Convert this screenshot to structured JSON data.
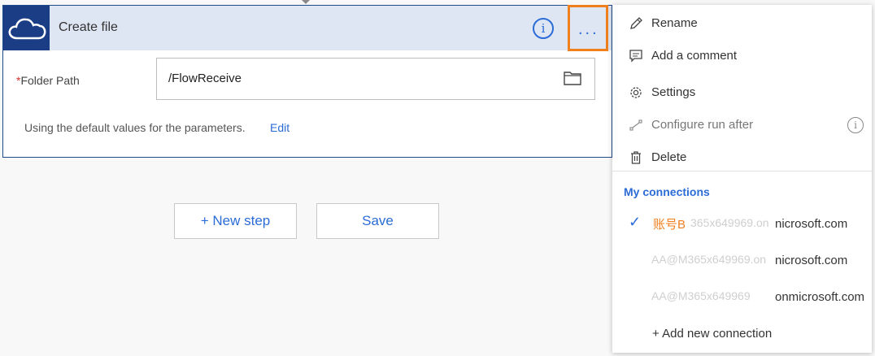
{
  "card": {
    "title": "Create file",
    "info_icon": "info-icon",
    "more_label": "...",
    "folder_path_required": "*",
    "folder_path_label": "Folder Path",
    "folder_path_value": "/FlowReceive",
    "defaults_text": "Using the default values for the parameters.",
    "edit_label": "Edit"
  },
  "buttons": {
    "new_step": "+ New step",
    "save": "Save"
  },
  "menu": {
    "items": [
      {
        "icon": "pencil-icon",
        "label": "Rename",
        "disabled": false
      },
      {
        "icon": "comment-icon",
        "label": "Add a comment",
        "disabled": false
      },
      {
        "icon": "gear-icon",
        "label": "Settings",
        "disabled": false
      },
      {
        "icon": "flow-icon",
        "label": "Configure run after",
        "disabled": true
      },
      {
        "icon": "trash-icon",
        "label": "Delete",
        "disabled": false
      }
    ],
    "connections_header": "My connections",
    "connections": [
      {
        "selected": true,
        "name": "账号B",
        "blurred": "365x649969.on",
        "domain": "nicrosoft.com"
      },
      {
        "selected": false,
        "name": "",
        "blurred": "AA@M365x649969.on",
        "domain": "nicrosoft.com"
      },
      {
        "selected": false,
        "name": "",
        "blurred": "AA@M365x649969",
        "domain": "onmicrosoft.com"
      }
    ],
    "add_connection": "+ Add new connection"
  },
  "colors": {
    "accent": "#2b6cd6",
    "highlight": "#f07f1e",
    "header_bg": "#dfe6f3",
    "logo_bg": "#1a3d86"
  }
}
